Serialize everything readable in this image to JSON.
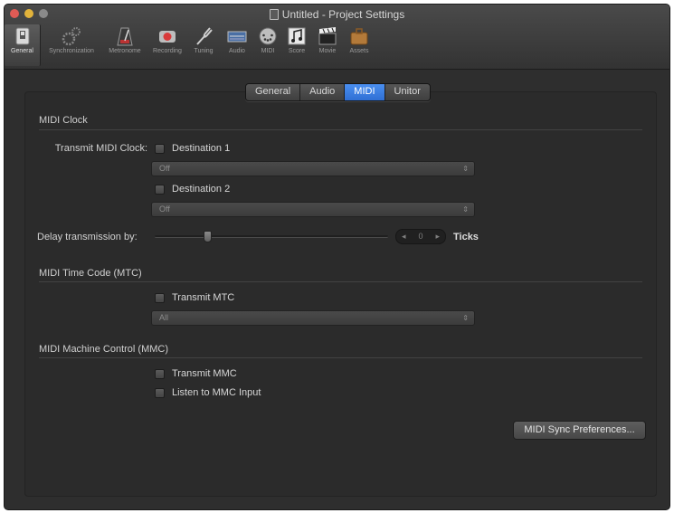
{
  "window": {
    "title": "Untitled - Project Settings"
  },
  "toolbar": {
    "items": [
      {
        "label": "General",
        "icon": "switch-icon"
      },
      {
        "label": "Synchronization",
        "icon": "gears-icon"
      },
      {
        "label": "Metronome",
        "icon": "metronome-icon"
      },
      {
        "label": "Recording",
        "icon": "record-icon"
      },
      {
        "label": "Tuning",
        "icon": "tuning-fork-icon"
      },
      {
        "label": "Audio",
        "icon": "audio-icon"
      },
      {
        "label": "MIDI",
        "icon": "midi-port-icon"
      },
      {
        "label": "Score",
        "icon": "score-icon"
      },
      {
        "label": "Movie",
        "icon": "clapperboard-icon"
      },
      {
        "label": "Assets",
        "icon": "briefcase-icon"
      }
    ],
    "selected": "General"
  },
  "tabs": [
    "General",
    "Audio",
    "MIDI",
    "Unitor"
  ],
  "active_tab": "MIDI",
  "midi_clock": {
    "heading": "MIDI Clock",
    "transmit_label": "Transmit MIDI Clock:",
    "dest1_label": "Destination 1",
    "dest1_value": "Off",
    "dest2_label": "Destination 2",
    "dest2_value": "Off",
    "delay_label": "Delay transmission by:",
    "delay_value": "0",
    "delay_unit": "Ticks"
  },
  "mtc": {
    "heading": "MIDI Time Code (MTC)",
    "transmit_label": "Transmit MTC",
    "dest_value": "All"
  },
  "mmc": {
    "heading": "MIDI Machine Control (MMC)",
    "transmit_label": "Transmit MMC",
    "listen_label": "Listen to MMC Input"
  },
  "sync_button": "MIDI Sync Preferences..."
}
